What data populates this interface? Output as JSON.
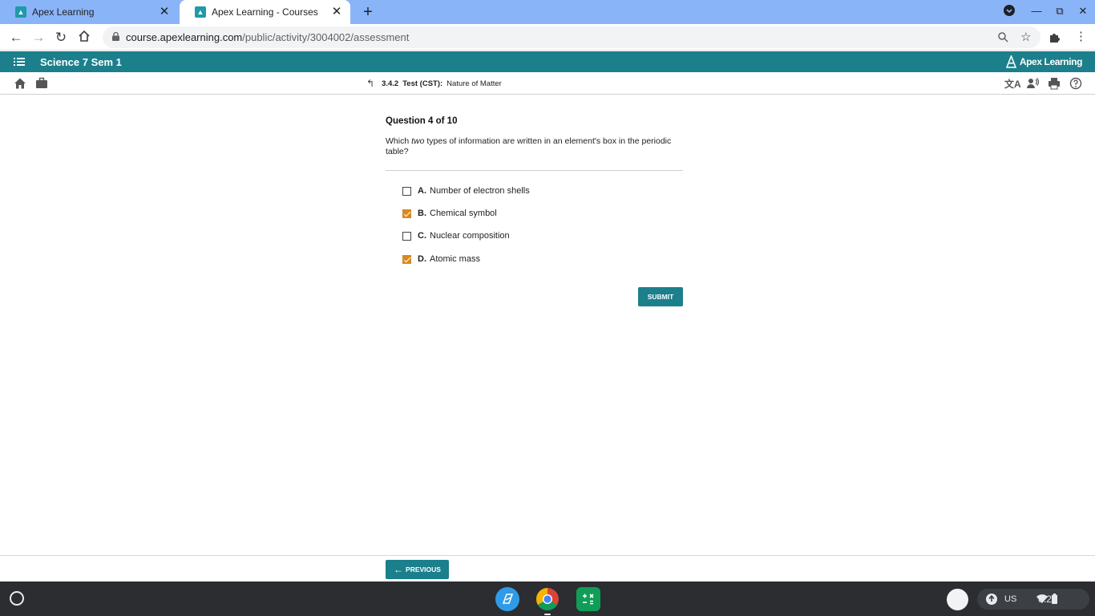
{
  "browser": {
    "tabs": [
      {
        "title": "Apex Learning",
        "active": false
      },
      {
        "title": "Apex Learning - Courses",
        "active": true
      }
    ],
    "url_host": "course.apexlearning.com",
    "url_path": "/public/activity/3004002/assessment"
  },
  "header": {
    "course_name": "Science 7 Sem 1",
    "logo_text": "Apex Learning",
    "accent_color": "#1b7f8c"
  },
  "breadcrumb": {
    "number": "3.4.2",
    "type": "Test (CST):",
    "title": "Nature of Matter"
  },
  "question": {
    "title": "Question 4 of 10",
    "text_before": "Which ",
    "text_emph": "two",
    "text_after": " types of information are written in an element's box in the periodic table?",
    "choices": [
      {
        "letter": "A.",
        "label": "Number of electron shells",
        "checked": false
      },
      {
        "letter": "B.",
        "label": "Chemical symbol",
        "checked": true
      },
      {
        "letter": "C.",
        "label": "Nuclear composition",
        "checked": false
      },
      {
        "letter": "D.",
        "label": "Atomic mass",
        "checked": true
      }
    ],
    "submit_label": "SUBMIT"
  },
  "footer": {
    "previous_label": "PREVIOUS"
  },
  "shelf": {
    "keyboard": "US",
    "time": "8:29"
  }
}
